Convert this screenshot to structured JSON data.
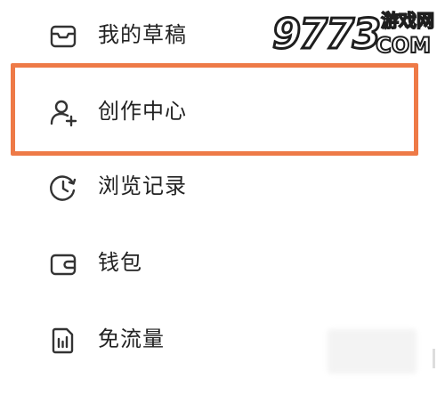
{
  "menu": {
    "items": [
      {
        "label": "我的草稿",
        "icon": "drafts-tray-icon"
      },
      {
        "label": "创作中心",
        "icon": "user-add-icon"
      },
      {
        "label": "浏览记录",
        "icon": "history-clock-icon"
      },
      {
        "label": "钱包",
        "icon": "wallet-icon"
      },
      {
        "label": "免流量",
        "icon": "data-usage-icon"
      }
    ],
    "highlighted_index": 1
  },
  "watermark": {
    "number": "9773",
    "site_name": "游戏网",
    "domain": "COM"
  },
  "colors": {
    "highlight_border": "#ee7a47",
    "text": "#222222",
    "icon_stroke": "#333333",
    "background": "#ffffff"
  }
}
